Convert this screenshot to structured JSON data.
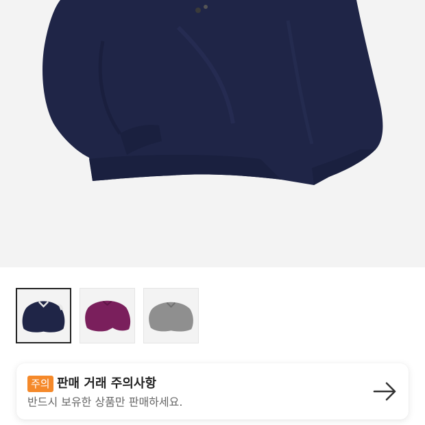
{
  "product": {
    "main_image": "navy-knit-sweater",
    "thumbnails": [
      {
        "name": "navy-sweater",
        "selected": true
      },
      {
        "name": "purple-sweater",
        "selected": false
      },
      {
        "name": "gray-sweater",
        "selected": false
      }
    ]
  },
  "notice": {
    "badge": "주의",
    "title": "판매 거래 주의사항",
    "subtitle": "반드시 보유한 상품만 판매하세요.",
    "arrow_icon": "arrow-right-icon",
    "badge_color": "#f5892a"
  },
  "colors": {
    "hero_bg": "#f3f3f3",
    "navy": "#1f2547",
    "purple": "#7a1f5c",
    "gray": "#8f8f8f"
  }
}
